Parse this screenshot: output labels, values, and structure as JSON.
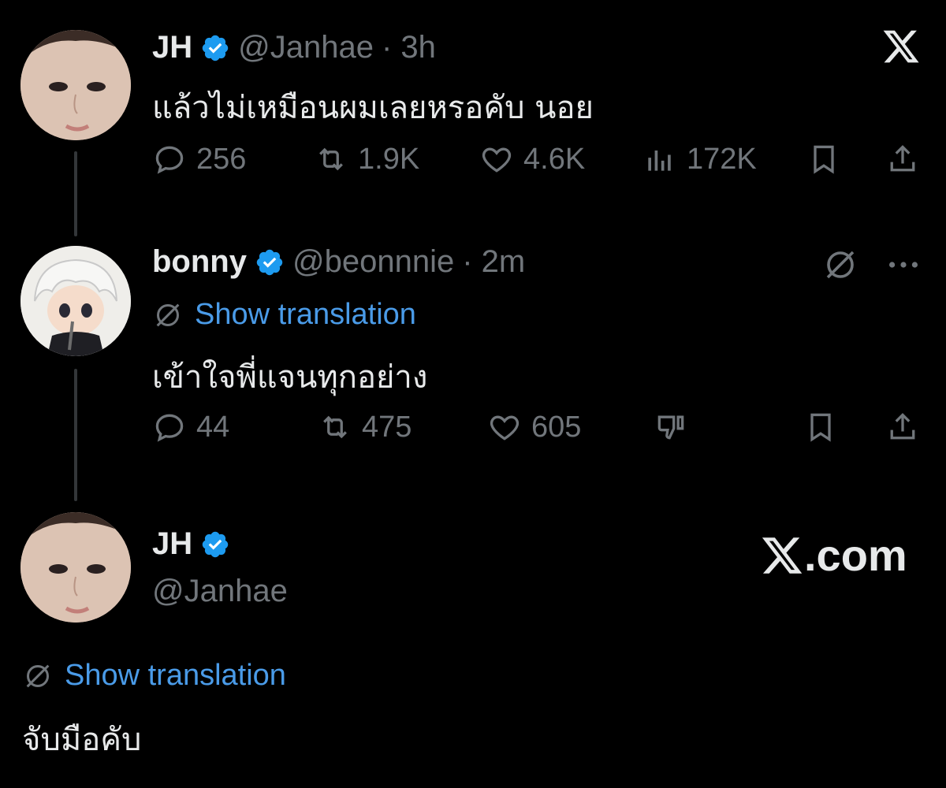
{
  "tweet1": {
    "name": "JH",
    "handle": "@Janhae",
    "time": "· 3h",
    "text": "แล้วไม่เหมือนผมเลยหรอคับ นอย",
    "replies": "256",
    "reposts": "1.9K",
    "likes": "4.6K",
    "views": "172K"
  },
  "tweet2": {
    "name": "bonny",
    "handle": "@beonnnie",
    "time": "· 2m",
    "translate_label": "Show translation",
    "text": "เข้าใจพี่แจนทุกอย่าง",
    "replies": "44",
    "reposts": "475",
    "likes": "605"
  },
  "tweet3": {
    "name": "JH",
    "handle": "@Janhae",
    "translate_label": "Show translation",
    "text": "จับมือคับ",
    "site_label": ".com"
  },
  "colors": {
    "background": "#000000",
    "text": "#e7e9ea",
    "muted": "#71767b",
    "link": "#4a9be8",
    "verified": "#1d9bf0"
  },
  "icons": [
    "x-logo-icon",
    "verified-badge-icon",
    "reply-icon",
    "repost-icon",
    "like-icon",
    "views-icon",
    "bookmark-icon",
    "share-icon",
    "translate-icon",
    "more-icon",
    "dislike-icon"
  ]
}
